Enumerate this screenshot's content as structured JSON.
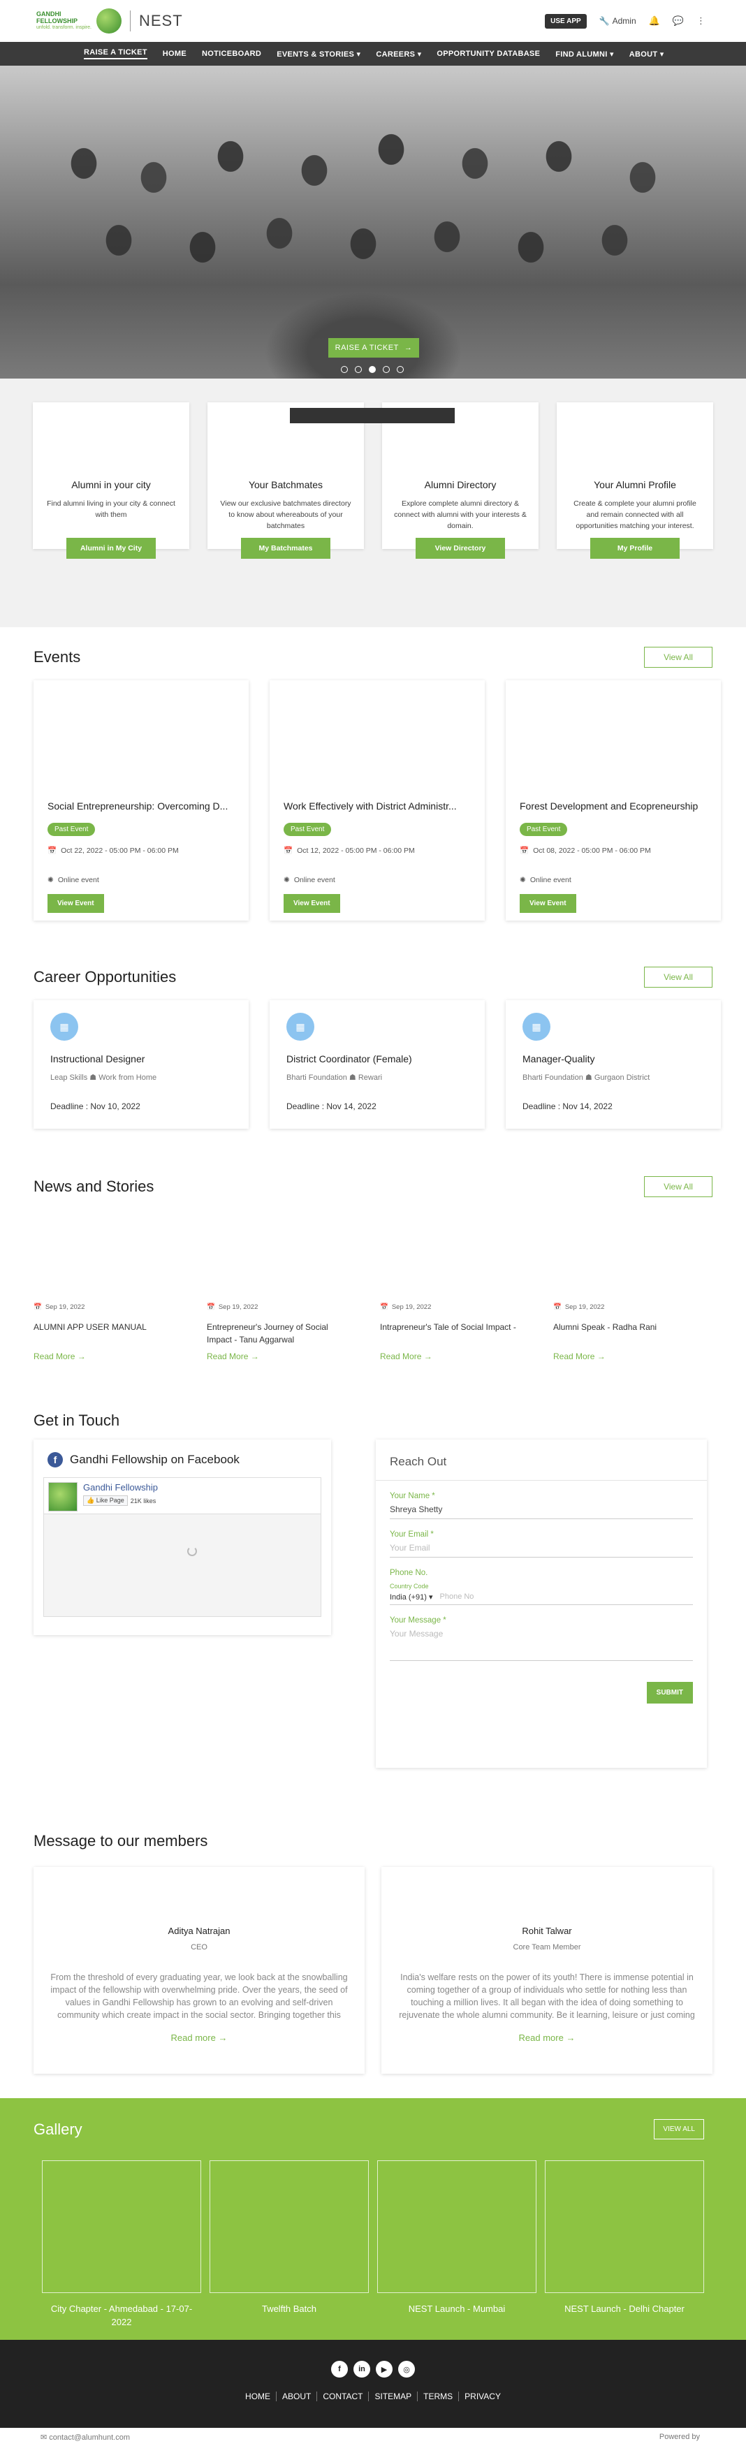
{
  "header": {
    "logo_line1": "GANDHI FELLOWSHIP",
    "logo_line2": "unfold. transform. inspire.",
    "app_name": "NEST",
    "use_app": "USE APP",
    "admin": "Admin"
  },
  "nav": [
    "RAISE A TICKET",
    "HOME",
    "NOTICEBOARD",
    "EVENTS & STORIES",
    "CAREERS",
    "OPPORTUNITY DATABASE",
    "FIND ALUMNI",
    "ABOUT"
  ],
  "hero": {
    "cta": "RAISE A TICKET"
  },
  "quick_links": [
    {
      "title": "Alumni in your city",
      "text": "Find alumni living in your city & connect with them",
      "button": "Alumni in My City"
    },
    {
      "title": "Your Batchmates",
      "text": "View our exclusive batchmates directory to know about whereabouts of your batchmates",
      "button": "My Batchmates"
    },
    {
      "title": "Alumni Directory",
      "text": "Explore complete alumni directory & connect with alumni with your interests & domain.",
      "button": "View Directory"
    },
    {
      "title": "Your Alumni Profile",
      "text": "Create & complete your alumni profile and remain connected with all opportunities matching your interest.",
      "button": "My Profile"
    }
  ],
  "events": {
    "heading": "Events",
    "view_all": "View All",
    "items": [
      {
        "title": "Social Entrepreneurship: Overcoming D...",
        "badge": "Past Event",
        "date": "Oct 22, 2022 - 05:00 PM - 06:00 PM",
        "mode": "Online event",
        "button": "View Event"
      },
      {
        "title": "Work Effectively with District Administr...",
        "badge": "Past Event",
        "date": "Oct 12, 2022 - 05:00 PM - 06:00 PM",
        "mode": "Online event",
        "button": "View Event"
      },
      {
        "title": "Forest Development and Ecopreneurship",
        "badge": "Past Event",
        "date": "Oct 08, 2022 - 05:00 PM - 06:00 PM",
        "mode": "Online event",
        "button": "View Event"
      }
    ]
  },
  "careers": {
    "heading": "Career Opportunities",
    "view_all": "View All",
    "items": [
      {
        "title": "Instructional Designer",
        "org": "Leap Skills",
        "location": "Work from Home",
        "deadline": "Deadline : Nov 10, 2022"
      },
      {
        "title": "District Coordinator (Female)",
        "org": "Bharti Foundation",
        "location": "Rewari",
        "deadline": "Deadline : Nov 14, 2022"
      },
      {
        "title": "Manager-Quality",
        "org": "Bharti Foundation",
        "location": "Gurgaon District",
        "deadline": "Deadline : Nov 14, 2022"
      }
    ]
  },
  "news": {
    "heading": "News and Stories",
    "view_all": "View All",
    "items": [
      {
        "date": "Sep 19, 2022",
        "title": "ALUMNI APP USER MANUAL",
        "more": "Read More →"
      },
      {
        "date": "Sep 19, 2022",
        "title": "Entrepreneur's Journey of Social Impact - Tanu Aggarwal",
        "more": "Read More →"
      },
      {
        "date": "Sep 19, 2022",
        "title": "Intrapreneur's Tale of Social Impact -",
        "more": "Read More →"
      },
      {
        "date": "Sep 19, 2022",
        "title": "Alumni Speak - Radha Rani",
        "more": "Read More →"
      }
    ]
  },
  "touch": {
    "heading": "Get in Touch",
    "facebook": {
      "title": "Gandhi Fellowship on Facebook",
      "page_name": "Gandhi Fellowship",
      "like": "Like Page",
      "likes": "21K likes"
    },
    "form": {
      "title": "Reach Out",
      "name_label": "Your Name *",
      "name_value": "Shreya Shetty",
      "email_label": "Your Email *",
      "email_placeholder": "Your Email",
      "phone_label": "Phone No.",
      "country_label": "Country Code",
      "country_value": "India (+91)",
      "phone_placeholder": "Phone No",
      "message_label": "Your Message *",
      "message_placeholder": "Your Message",
      "submit": "SUBMIT"
    }
  },
  "messages": {
    "heading": "Message to our members",
    "items": [
      {
        "name": "Aditya Natrajan",
        "role": "CEO",
        "text": "From the threshold of every graduating year, we look back at the snowballing impact of the fellowship with overwhelming pride. Over the years, the seed of values in Gandhi Fellowship has grown to an evolving and self-driven community which create impact in the social sector. Bringing together this community is paramount to discussing the world's problems",
        "more": "Read more →"
      },
      {
        "name": "Rohit Talwar",
        "role": "Core Team Member",
        "text": "India's welfare rests on the power of its youth! There is immense potential in coming together of a group of individuals who settle for nothing less than touching a million lives. It all began with the idea of doing something to rejuvenate the whole alumni community. Be it learning, leisure or just coming together to share and celebrate, what better way than to do it with",
        "more": "Read more →"
      }
    ]
  },
  "gallery": {
    "heading": "Gallery",
    "view_all": "VIEW ALL",
    "items": [
      "City Chapter - Ahmedabad - 17-07-2022",
      "Twelfth Batch",
      "NEST Launch - Mumbai",
      "NEST Launch - Delhi Chapter"
    ]
  },
  "footer": {
    "links": [
      "HOME",
      "ABOUT",
      "CONTACT",
      "SITEMAP",
      "TERMS",
      "PRIVACY"
    ],
    "email": "contact@alumhunt.com",
    "powered": "Powered by"
  },
  "colors": {
    "accent": "#7ab648",
    "nav_bg": "#3b3b3b",
    "gallery_bg": "#8dc342",
    "footer_bg": "#222222"
  }
}
